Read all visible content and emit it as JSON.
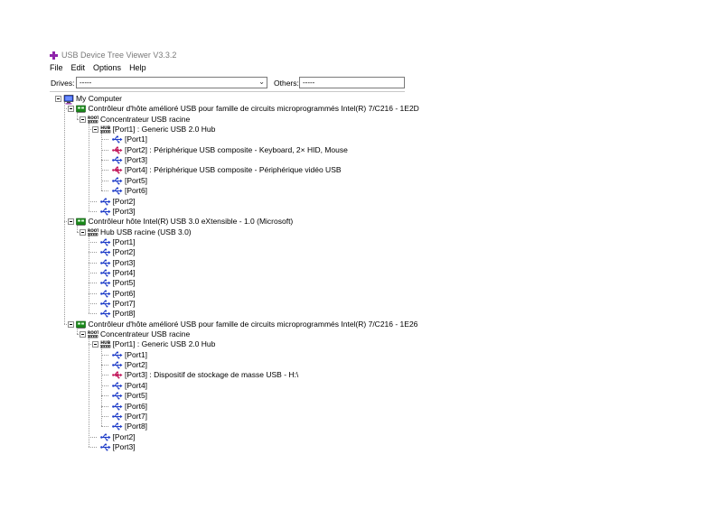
{
  "window": {
    "title": "USB Device Tree Viewer V3.3.2"
  },
  "menu": [
    "File",
    "Edit",
    "Options",
    "Help"
  ],
  "toolbar": {
    "drives_label": "Drives:",
    "drives_value": "-----",
    "others_label": "Others:",
    "others_value": "-----"
  },
  "tree": {
    "root": "My Computer",
    "controllers": [
      {
        "label": "Contrôleur d'hôte amélioré USB pour famille de circuits microprogrammés Intel(R) 7/C216 - 1E2D",
        "root_hub": "Concentrateur USB racine",
        "hub_port": "[Port1] : Generic USB 2.0 Hub",
        "hub_ports": [
          "[Port1]",
          "[Port2] : Périphérique USB composite - Keyboard, 2× HID, Mouse",
          "[Port3]",
          "[Port4] : Périphérique USB composite - Périphérique vidéo USB",
          "[Port5]",
          "[Port6]"
        ],
        "root_ports": [
          "[Port2]",
          "[Port3]"
        ]
      },
      {
        "label": "Contrôleur hôte Intel(R) USB 3.0 eXtensible - 1.0 (Microsoft)",
        "root_hub": "Hub USB racine (USB 3.0)",
        "root_ports": [
          "[Port1]",
          "[Port2]",
          "[Port3]",
          "[Port4]",
          "[Port5]",
          "[Port6]",
          "[Port7]",
          "[Port8]"
        ]
      },
      {
        "label": "Contrôleur d'hôte amélioré USB pour famille de circuits microprogrammés Intel(R) 7/C216 - 1E26",
        "root_hub": "Concentrateur USB racine",
        "hub_port": "[Port1] : Generic USB 2.0 Hub",
        "hub_ports": [
          "[Port1]",
          "[Port2]",
          "[Port3] : Dispositif de stockage de masse USB - H:\\",
          "[Port4]",
          "[Port5]",
          "[Port6]",
          "[Port7]",
          "[Port8]"
        ],
        "root_ports": [
          "[Port2]",
          "[Port3]"
        ]
      }
    ]
  },
  "icons": {
    "app": "usb-app-icon",
    "computer": "computer-icon",
    "controller": "usb-controller-icon",
    "root_hub": "root-hub-icon",
    "hub": "usb-hub-icon",
    "port_empty": "usb-port-icon",
    "port_device": "usb-device-icon"
  },
  "colors": {
    "controller_green": "#1a8a1a",
    "port_blue": "#1e3cc8",
    "device_magenta": "#c2185b",
    "app_purple": "#8e24aa"
  }
}
